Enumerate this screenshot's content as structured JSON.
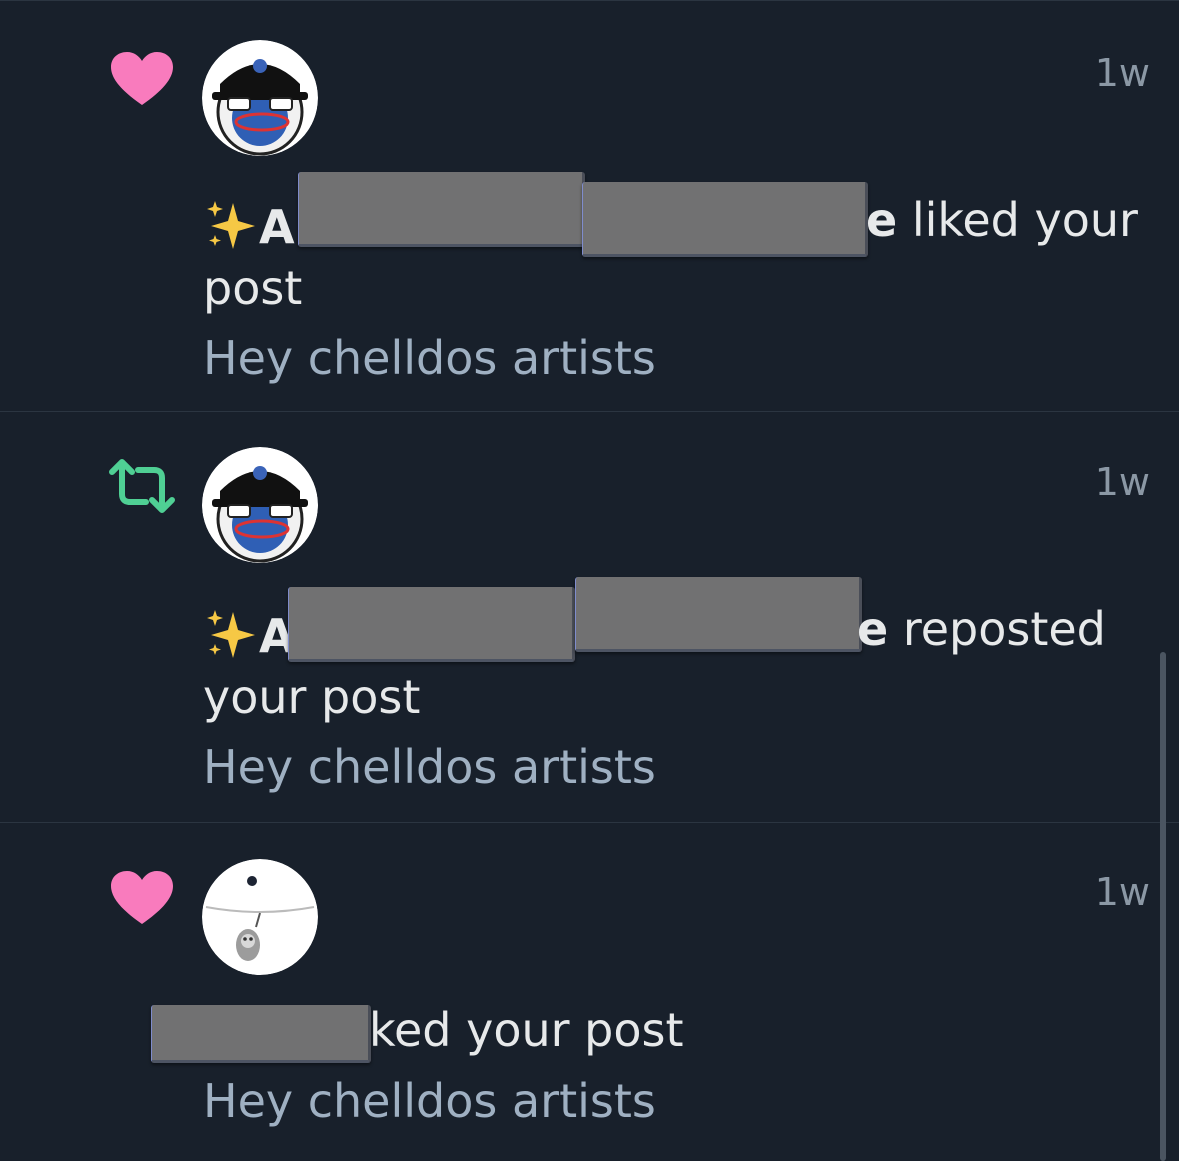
{
  "notifications": [
    {
      "type": "like",
      "icon": "heart-icon",
      "time": "1w",
      "name_start": "A",
      "name_end": "e",
      "action": " liked your",
      "action_wrap": "post",
      "preview": "Hey chelldos artists"
    },
    {
      "type": "repost",
      "icon": "repost-icon",
      "time": "1w",
      "name_start": "A",
      "name_end": "e",
      "action": " reposted",
      "action_wrap": "your post",
      "preview": "Hey chelldos artists"
    },
    {
      "type": "like",
      "icon": "heart-icon",
      "time": "1w",
      "action": "ked your post",
      "preview": "Hey chelldos artists"
    }
  ],
  "colors": {
    "background": "#18202b",
    "like": "#f97bbd",
    "repost": "#4fcf94",
    "muted_text": "#8b98a5",
    "preview_text": "#9fb0c2"
  }
}
